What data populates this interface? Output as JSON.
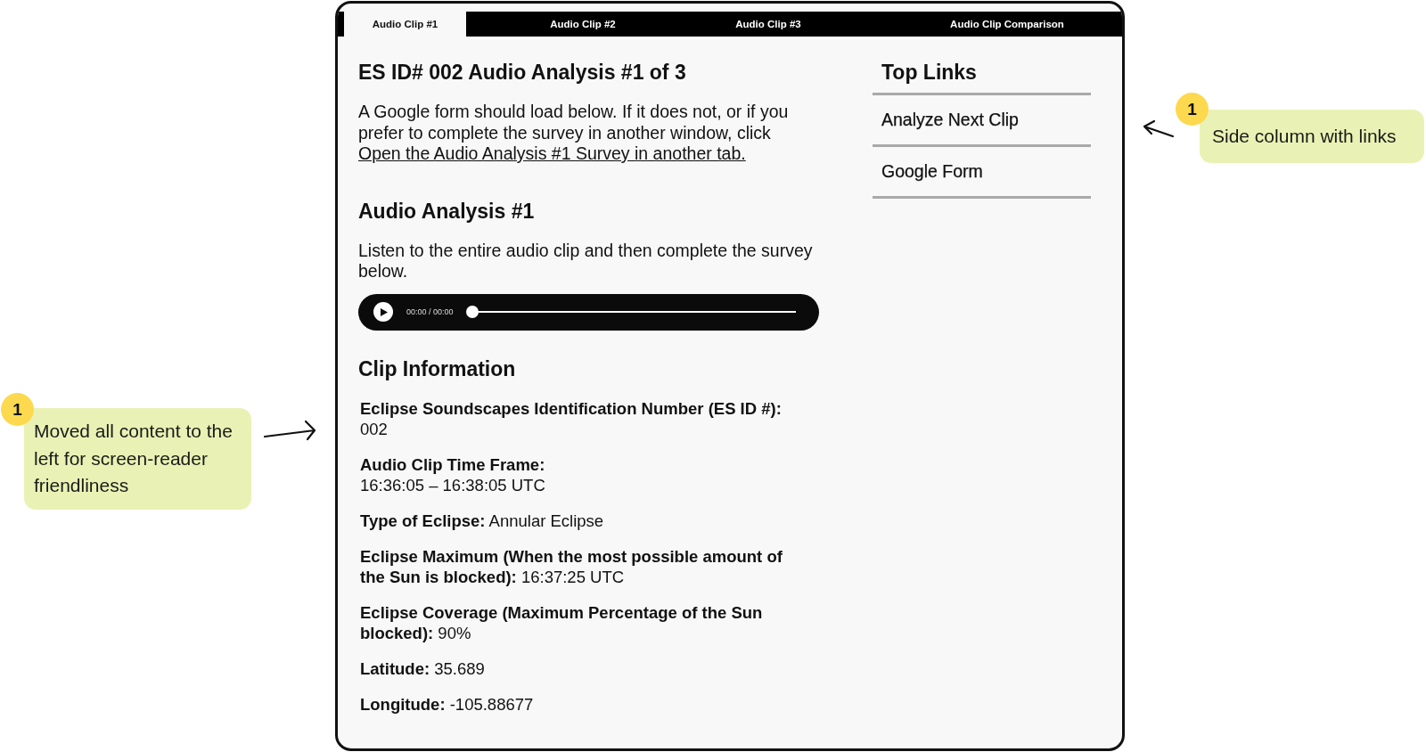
{
  "tabs": [
    {
      "label": "Audio Clip #1",
      "selected": true
    },
    {
      "label": "Audio Clip #2",
      "selected": false
    },
    {
      "label": "Audio Clip #3",
      "selected": false
    },
    {
      "label": "Audio Clip Comparison",
      "selected": false
    }
  ],
  "main": {
    "title": "ES ID# 002 Audio Analysis #1 of 3",
    "intro": {
      "text": "A Google form should load below. If it does not, or if you prefer to complete the survey in another window, click",
      "link": "Open the Audio Analysis #1 Survey in another tab."
    },
    "survey_heading": "Audio Analysis #1",
    "instructions": "Listen to the entire audio clip and then complete the survey below.",
    "player": {
      "time": "00:00 / 00:00",
      "level": 0
    },
    "info_heading": "Clip Information",
    "info": [
      {
        "kind": "stacked",
        "label": "Eclipse Soundscapes Identification Number (ES ID #):",
        "value": "002"
      },
      {
        "kind": "stacked",
        "label": "Audio Clip Time Frame:",
        "value": "16:36:05 – 16:38:05 UTC"
      },
      {
        "kind": "inline",
        "label": "Type of Eclipse:",
        "value": "Annular Eclipse"
      },
      {
        "kind": "inline",
        "label": "Eclipse Maximum (When the most possible amount of the Sun is blocked):",
        "value": "16:37:25 UTC"
      },
      {
        "kind": "inline",
        "label": "Eclipse Coverage (Maximum Percentage of the Sun blocked):",
        "value": "90%"
      },
      {
        "kind": "inline",
        "label": "Latitude:",
        "value": "35.689"
      },
      {
        "kind": "inline",
        "label": "Longitude:",
        "value": "-105.88677"
      }
    ]
  },
  "side": {
    "heading": "Top Links",
    "links": [
      "Analyze Next Clip",
      "Google Form"
    ]
  },
  "annotations": [
    {
      "kind": "left",
      "badge": "1",
      "text": "Moved all content to the left for screen-reader friendliness"
    },
    {
      "kind": "right",
      "badge": "1",
      "text": "Side column with links"
    }
  ]
}
